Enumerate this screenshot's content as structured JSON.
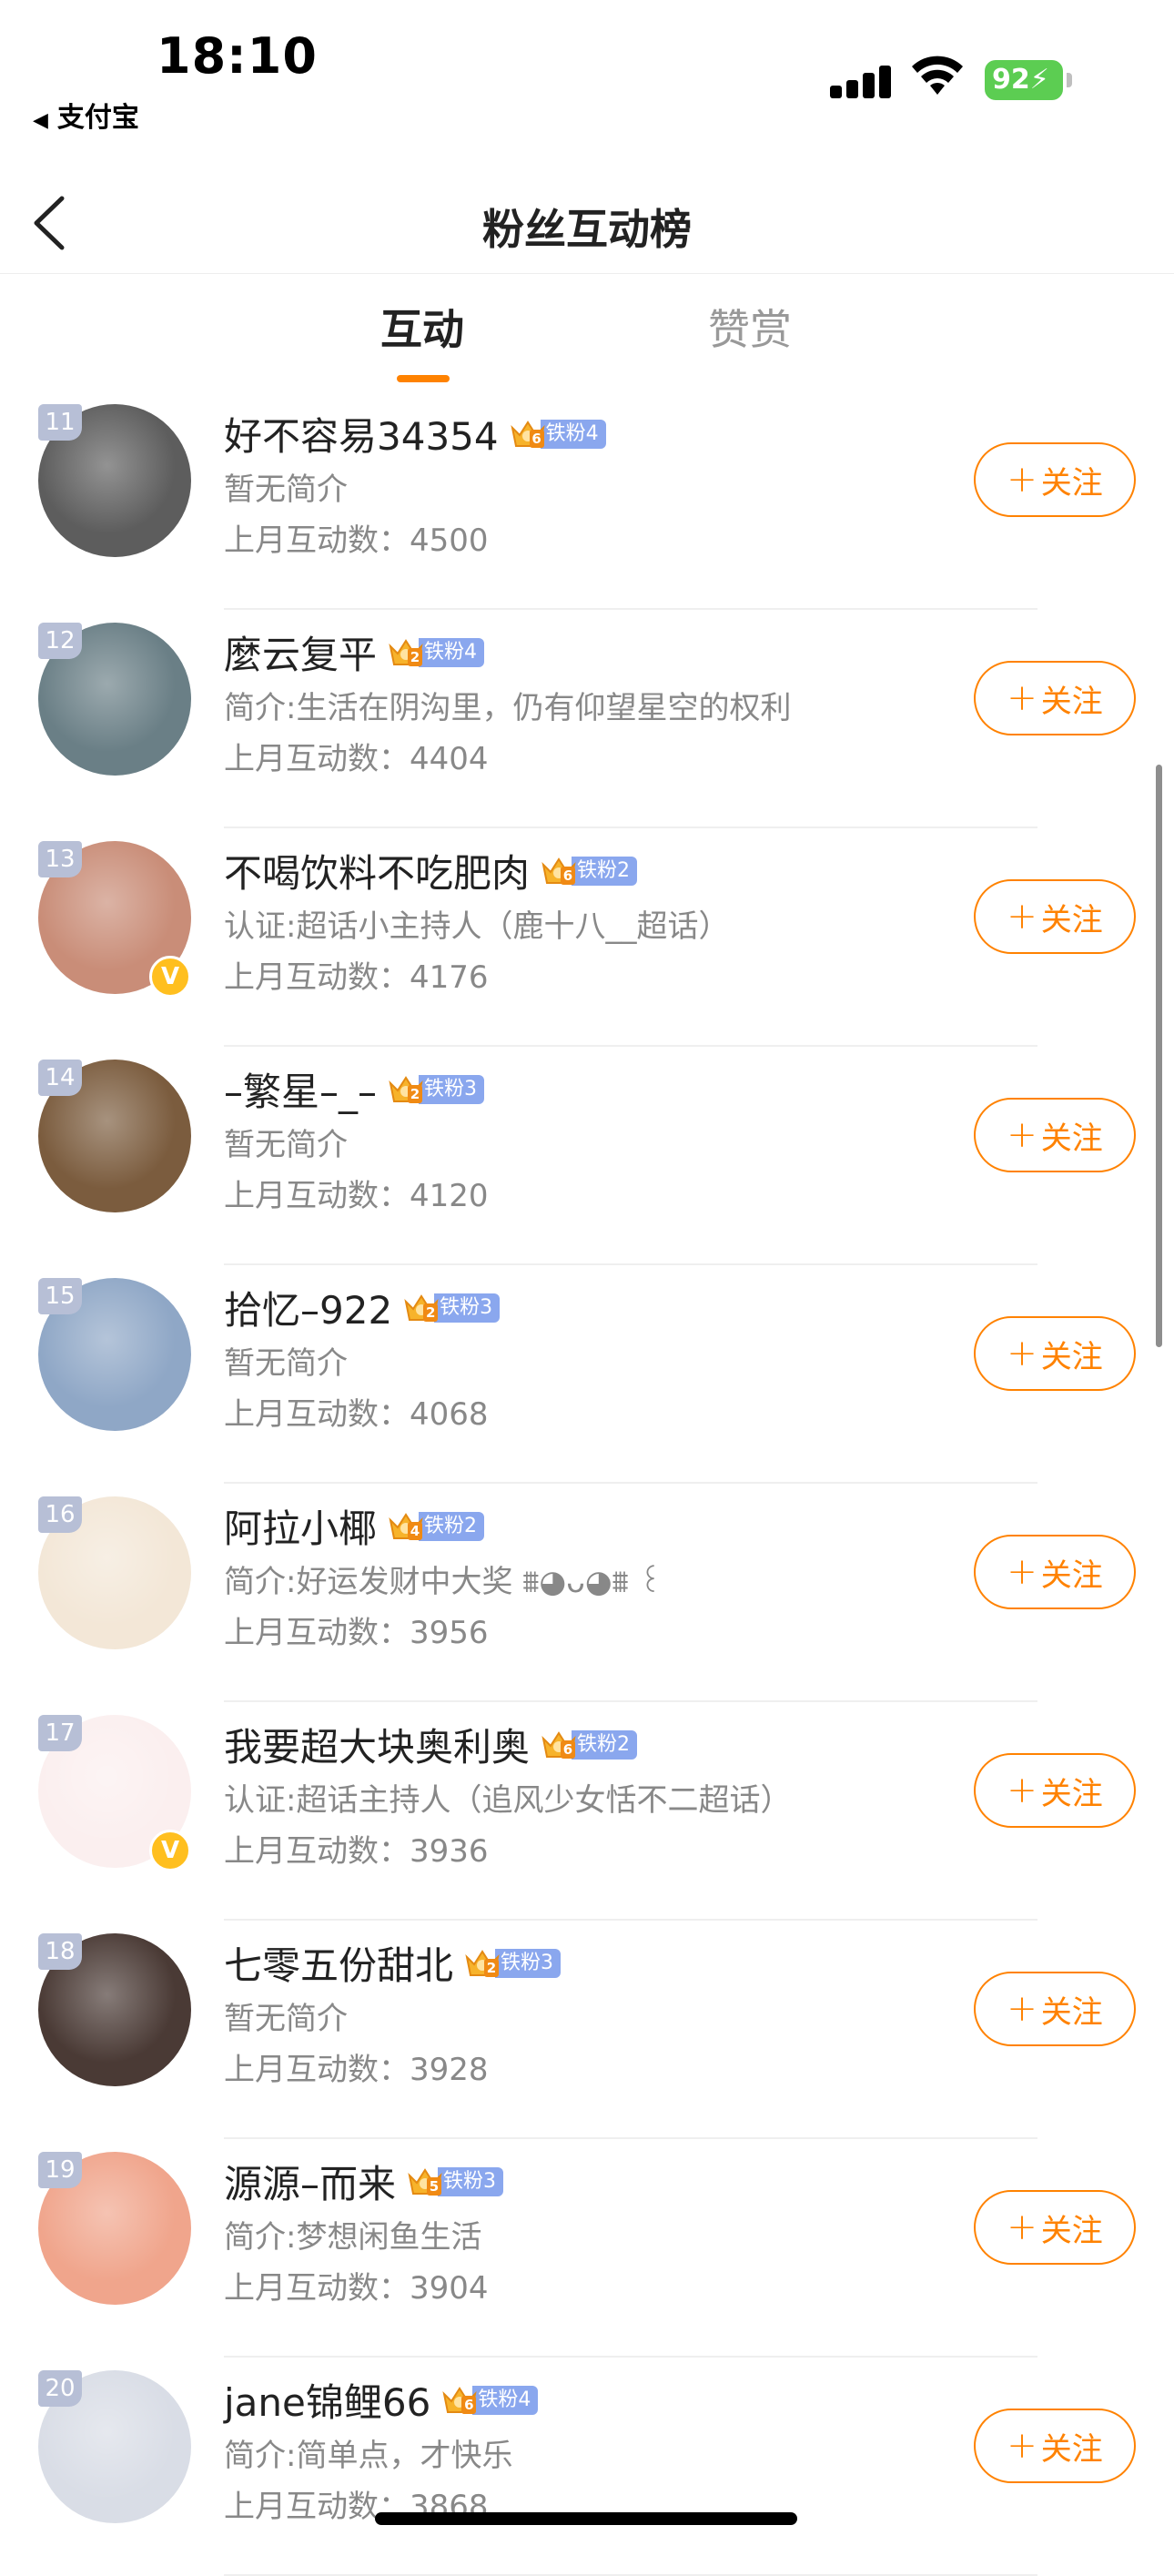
{
  "status_bar": {
    "time": "18:10",
    "back_app": "支付宝",
    "battery": "92"
  },
  "nav": {
    "title": "粉丝互动榜"
  },
  "tabs": [
    {
      "label": "互动",
      "active": true
    },
    {
      "label": "赞赏",
      "active": false
    }
  ],
  "follow_label": "关注",
  "follow_plus": "+",
  "verified_mark": "V",
  "rows": [
    {
      "rank": "11",
      "name": "好不容易34354",
      "fan_label": "铁粉4",
      "crown_level": "6",
      "bio": "暂无简介",
      "count": "上月互动数：4500",
      "verified": false,
      "avatar_color": "#5d5d5d"
    },
    {
      "rank": "12",
      "name": "麼云复平",
      "fan_label": "铁粉4",
      "crown_level": "2",
      "bio": "简介:生活在阴沟里，仍有仰望星空的权利",
      "count": "上月互动数：4404",
      "verified": false,
      "avatar_color": "#6a7f86"
    },
    {
      "rank": "13",
      "name": "不喝饮料不吃肥肉",
      "fan_label": "铁粉2",
      "crown_level": "6",
      "bio": "认证:超话小主持人（鹿十八__超话）",
      "count": "上月互动数：4176",
      "verified": true,
      "avatar_color": "#c98d78"
    },
    {
      "rank": "14",
      "name": "–繁星–_–",
      "fan_label": "铁粉3",
      "crown_level": "2",
      "bio": "暂无简介",
      "count": "上月互动数：4120",
      "verified": false,
      "avatar_color": "#7b5c3e"
    },
    {
      "rank": "15",
      "name": "拾忆–922",
      "fan_label": "铁粉3",
      "crown_level": "2",
      "bio": "暂无简介",
      "count": "上月互动数：4068",
      "verified": false,
      "avatar_color": "#8fa7c6"
    },
    {
      "rank": "16",
      "name": "阿拉小椰",
      "fan_label": "铁粉2",
      "crown_level": "4",
      "bio": "简介:好运发财中大奖 ⩩◕ᴗ◕⩩ ꒰",
      "count": "上月互动数：3956",
      "verified": false,
      "avatar_color": "#f3e7d7"
    },
    {
      "rank": "17",
      "name": "我要超大块奥利奥",
      "fan_label": "铁粉2",
      "crown_level": "6",
      "bio": "认证:超话主持人（追风少女恬不二超话）",
      "count": "上月互动数：3936",
      "verified": true,
      "avatar_color": "#fbefef"
    },
    {
      "rank": "18",
      "name": "七零五份甜北",
      "fan_label": "铁粉3",
      "crown_level": "2",
      "bio": "暂无简介",
      "count": "上月互动数：3928",
      "verified": false,
      "avatar_color": "#4a3a35"
    },
    {
      "rank": "19",
      "name": "源源–而来",
      "fan_label": "铁粉3",
      "crown_level": "5",
      "bio": "简介:梦想闲鱼生活",
      "count": "上月互动数：3904",
      "verified": false,
      "avatar_color": "#f0a58c"
    },
    {
      "rank": "20",
      "name": "jane锦鲤66",
      "fan_label": "铁粉4",
      "crown_level": "6",
      "bio": "简介:简单点，才快乐",
      "count": "上月互动数：3868",
      "verified": false,
      "avatar_color": "#d9dde6"
    }
  ]
}
